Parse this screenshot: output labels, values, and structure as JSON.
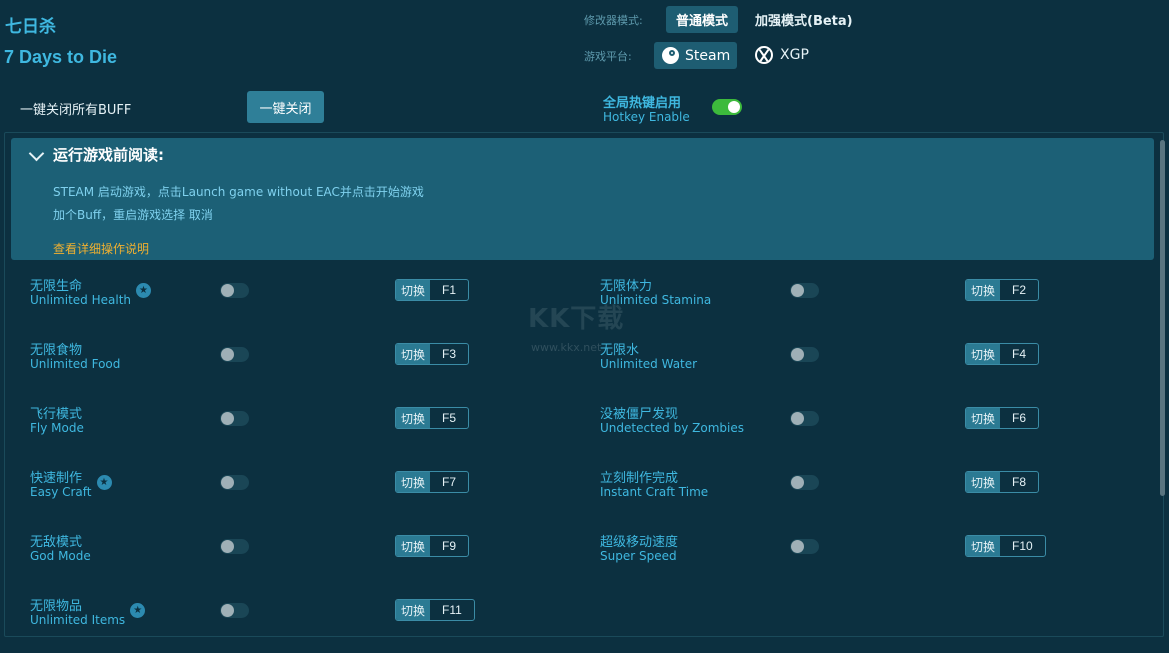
{
  "header": {
    "title_cn": "七日杀",
    "title_en": "7 Days to Die"
  },
  "mode": {
    "label": "修改器模式:",
    "normal": "普通模式",
    "enhanced": "加强模式(Beta)"
  },
  "platform": {
    "label": "游戏平台:",
    "steam": "Steam",
    "xgp": "XGP"
  },
  "buff": {
    "label": "一键关闭所有BUFF",
    "button": "一键关闭"
  },
  "hotkey": {
    "cn": "全局热键启用",
    "en": "Hotkey Enable",
    "enabled": true
  },
  "notice": {
    "title": "运行游戏前阅读:",
    "line1": "STEAM 启动游戏，点击Launch game without EAC并点击开始游戏",
    "line2": "加个Buff，重启游戏选择 取消",
    "link": "查看详细操作说明"
  },
  "switch_label": "切换",
  "watermark": {
    "logo": "KK下载",
    "url": "www.kkx.net"
  },
  "cheats": [
    {
      "cn": "无限生命",
      "en": "Unlimited Health",
      "star": true,
      "key": "F1",
      "on": false
    },
    {
      "cn": "无限体力",
      "en": "Unlimited Stamina",
      "star": false,
      "key": "F2",
      "on": false
    },
    {
      "cn": "无限食物",
      "en": "Unlimited Food",
      "star": false,
      "key": "F3",
      "on": false
    },
    {
      "cn": "无限水",
      "en": "Unlimited Water",
      "star": false,
      "key": "F4",
      "on": false
    },
    {
      "cn": "飞行模式",
      "en": "Fly Mode",
      "star": false,
      "key": "F5",
      "on": false
    },
    {
      "cn": "没被僵尸发现",
      "en": "Undetected by Zombies",
      "star": false,
      "key": "F6",
      "on": false
    },
    {
      "cn": "快速制作",
      "en": "Easy Craft",
      "star": true,
      "key": "F7",
      "on": false
    },
    {
      "cn": "立刻制作完成",
      "en": "Instant Craft Time",
      "star": false,
      "key": "F8",
      "on": false
    },
    {
      "cn": "无敌模式",
      "en": "God Mode",
      "star": false,
      "key": "F9",
      "on": false
    },
    {
      "cn": "超级移动速度",
      "en": "Super Speed",
      "star": false,
      "key": "F10",
      "on": false
    },
    {
      "cn": "无限物品",
      "en": "Unlimited Items",
      "star": true,
      "key": "F11",
      "on": false
    }
  ]
}
